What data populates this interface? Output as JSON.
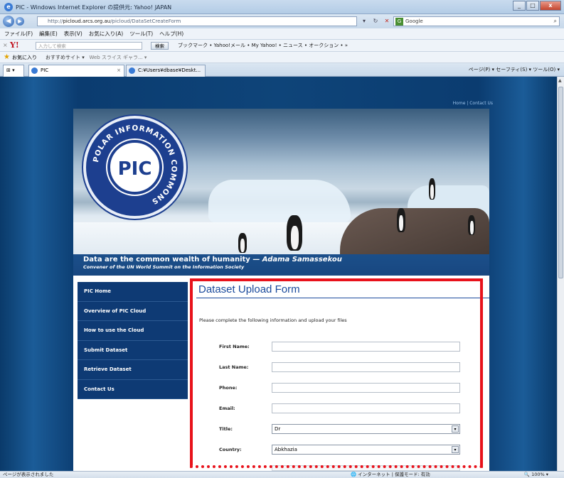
{
  "window": {
    "title": "PIC - Windows Internet Explorer の提供元: Yahoo! JAPAN",
    "controls": [
      "_",
      "□",
      "x"
    ]
  },
  "addressbar": {
    "url_prefix": "http://",
    "url_domain": "picloud.arcs.org.au",
    "url_path": "/picloud/DataSetCreateForm",
    "search_placeholder": "Google"
  },
  "menubar": {
    "items": [
      "ファイル(F)",
      "編集(E)",
      "表示(V)",
      "お気に入り(A)",
      "ツール(T)",
      "ヘルプ(H)"
    ]
  },
  "yahoo_toolbar": {
    "input_placeholder": "入力して検索",
    "search_button": "検索",
    "items": "ブックマーク • Yahoo!メール • My Yahoo! • ニュース • オークション • »"
  },
  "favorites_bar": {
    "label": "お気に入り",
    "items": "おすすめサイト ▾",
    "items2": "Web スライス ギャラ... ▾"
  },
  "tabs": [
    {
      "label": "PIC"
    },
    {
      "label": "C:¥Users¥dbase¥Deskt..."
    }
  ],
  "tab_tools": "ページ(P) ▾  セーフティ(S) ▾  ツール(O) ▾",
  "page": {
    "toplinks": "Home  |  Contact Us",
    "banner": {
      "seal_text": "PIC",
      "seal_ring": "POLAR INFORMATION COMMONS",
      "quote_main": "Data are the common wealth of humanity — ",
      "quote_author": "Adama Samassekou",
      "quote_sub": "Convener of the UN World Summit on the Information Society"
    },
    "nav": [
      {
        "label": "PIC Home"
      },
      {
        "label": "Overview of PIC Cloud"
      },
      {
        "label": "How to use the Cloud"
      },
      {
        "label": "Submit Dataset"
      },
      {
        "label": "Retrieve Dataset"
      },
      {
        "label": "Contact Us"
      }
    ],
    "form": {
      "title": "Dataset Upload Form",
      "intro": "Please complete the following information and upload your files",
      "fields": [
        {
          "label": "First Name:",
          "value": ""
        },
        {
          "label": "Last Name:",
          "value": ""
        },
        {
          "label": "Phone:",
          "value": ""
        },
        {
          "label": "Email:",
          "value": ""
        }
      ],
      "title_field": {
        "label": "Title:",
        "value": "Dr"
      },
      "country_field": {
        "label": "Country:",
        "value": "Abkhazia"
      }
    }
  },
  "statusbar": {
    "left": "ページが表示されました",
    "mid": "インターネット | 保護モード: 有効",
    "right": "100%"
  }
}
